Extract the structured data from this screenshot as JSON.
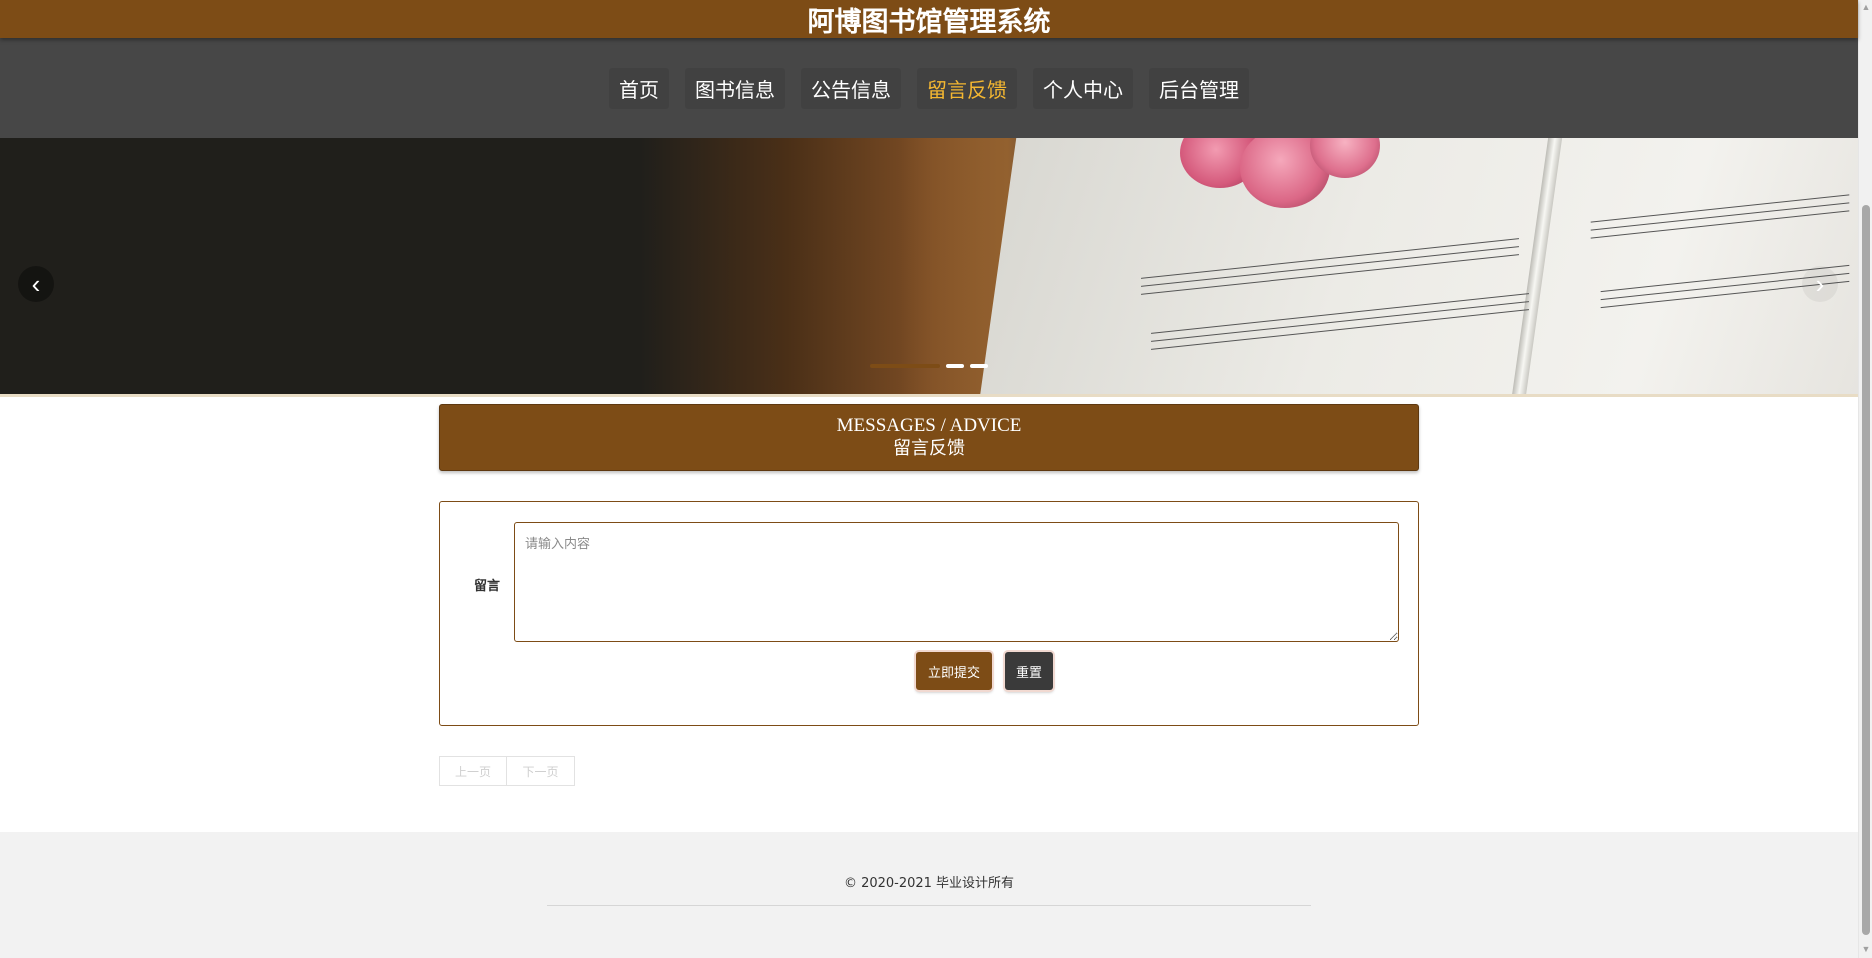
{
  "site": {
    "title": "阿博图书馆管理系统"
  },
  "nav": {
    "items": [
      {
        "label": "首页",
        "active": false
      },
      {
        "label": "图书信息",
        "active": false
      },
      {
        "label": "公告信息",
        "active": false
      },
      {
        "label": "留言反馈",
        "active": true
      },
      {
        "label": "个人中心",
        "active": false
      },
      {
        "label": "后台管理",
        "active": false
      }
    ],
    "active_color": "#f4b731"
  },
  "banner": {
    "prev_symbol": "‹",
    "next_symbol": "›",
    "slide_count": 3,
    "active_slide": 1
  },
  "section": {
    "title_en": "MESSAGES / ADVICE",
    "title_cn": "留言反馈"
  },
  "form": {
    "label": "留言",
    "placeholder": "请输入内容",
    "value": "",
    "submit_label": "立即提交",
    "reset_label": "重置"
  },
  "pagination": {
    "prev_label": "上一页",
    "next_label": "下一页"
  },
  "footer": {
    "copyright": "© 2020-2021 毕业设计所有"
  },
  "colors": {
    "brand": "#7d4c16",
    "nav_bg": "#474747",
    "footer_bg": "#f2f2f2"
  }
}
